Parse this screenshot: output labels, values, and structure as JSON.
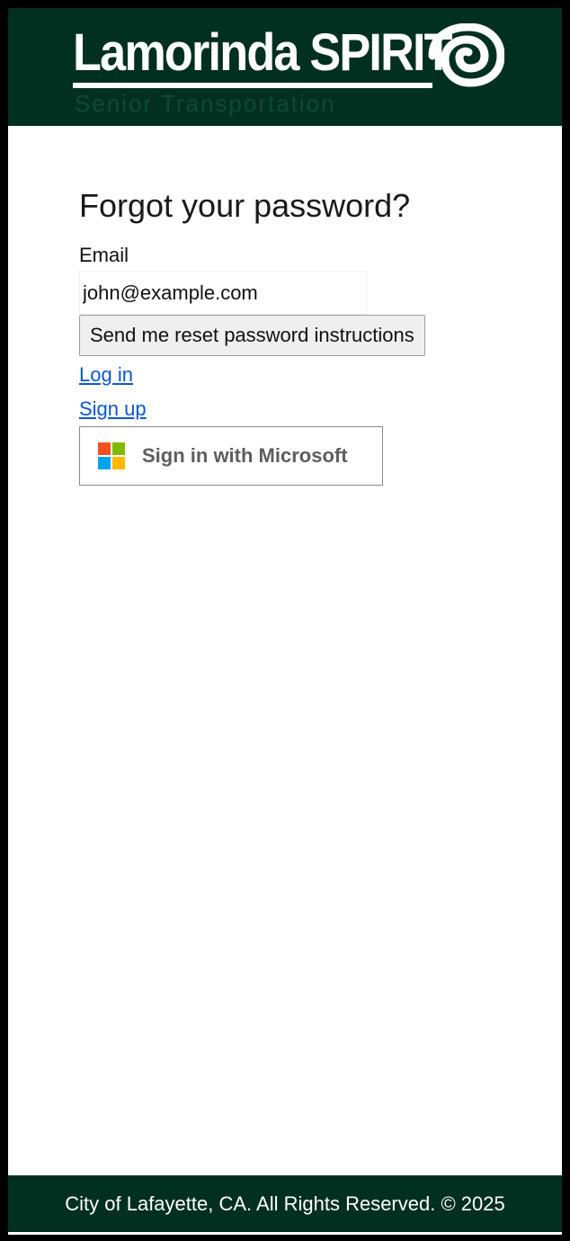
{
  "header": {
    "logo_text": "Lamorinda SPIRIT",
    "logo_tagline": "Senior Transportation",
    "background_color": "#023020"
  },
  "form": {
    "title": "Forgot your password?",
    "email_label": "Email",
    "email_value": "john@example.com",
    "submit_label": "Send me reset password instructions"
  },
  "links": {
    "login": "Log in",
    "signup": "Sign up"
  },
  "microsoft": {
    "label": "Sign in with Microsoft",
    "icon": "microsoft-logo-icon",
    "colors": [
      "#f25022",
      "#7fba00",
      "#00a4ef",
      "#ffb900"
    ]
  },
  "footer": {
    "text": "City of Lafayette, CA. All Rights Reserved. © 2025"
  }
}
